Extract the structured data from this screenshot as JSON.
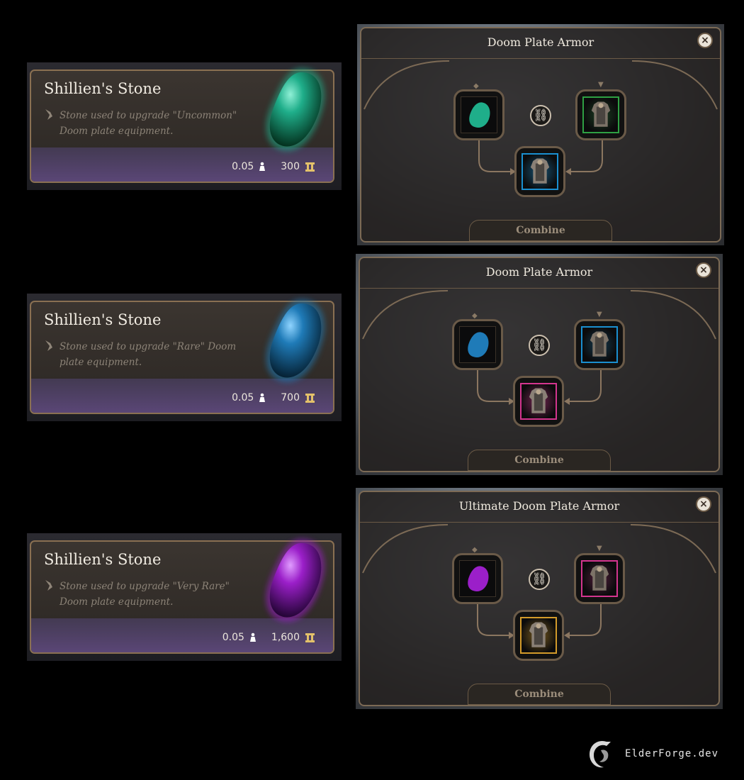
{
  "items": [
    {
      "name": "Shillien's Stone",
      "description": "Stone used to upgrade \"Uncommon\" Doom plate equipment.",
      "weight": "0.05",
      "price": "300",
      "stone_color": "#1fae8a"
    },
    {
      "name": "Shillien's Stone",
      "description": "Stone used to upgrade \"Rare\" Doom plate equipment.",
      "weight": "0.05",
      "price": "700",
      "stone_color": "#1f7bb8"
    },
    {
      "name": "Shillien's Stone",
      "description": "Stone used to upgrade \"Very Rare\" Doom plate equipment.",
      "weight": "0.05",
      "price": "1,600",
      "stone_color": "#9b1fc9"
    }
  ],
  "panels": [
    {
      "title": "Doom Plate Armor",
      "close_label": "×",
      "link_icon": "chain-link-icon",
      "combine_label": "Combine",
      "stone_color": "#1fae8a",
      "input_rarity_color": "#2ea043",
      "result_rarity_color": "#1a8fd0"
    },
    {
      "title": "Doom Plate Armor",
      "close_label": "×",
      "link_icon": "chain-link-icon",
      "combine_label": "Combine",
      "stone_color": "#1f7bb8",
      "input_rarity_color": "#1a8fd0",
      "result_rarity_color": "#d4358f"
    },
    {
      "title": "Ultimate Doom Plate Armor",
      "close_label": "×",
      "link_icon": "chain-link-icon",
      "combine_label": "Combine",
      "stone_color": "#9b1fc9",
      "input_rarity_color": "#d4358f",
      "result_rarity_color": "#d39b2a"
    }
  ],
  "watermark": {
    "text": "ElderForge.dev"
  }
}
